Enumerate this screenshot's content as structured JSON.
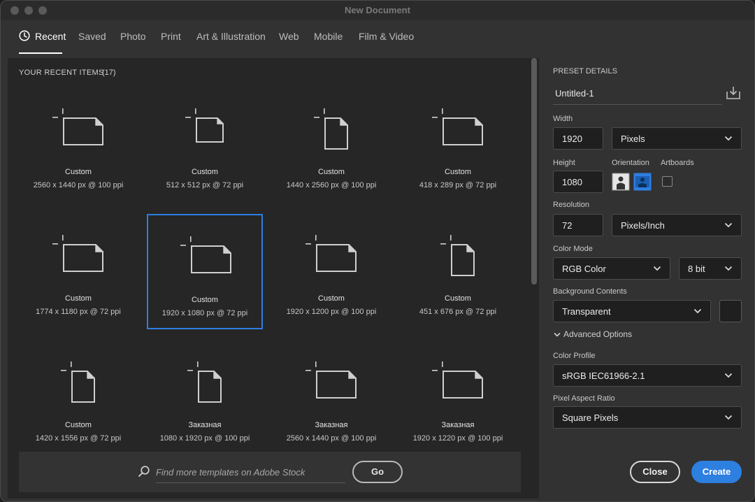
{
  "window": {
    "title": "New Document"
  },
  "tabs": [
    {
      "label": "Recent"
    },
    {
      "label": "Saved"
    },
    {
      "label": "Photo"
    },
    {
      "label": "Print"
    },
    {
      "label": "Art & Illustration"
    },
    {
      "label": "Web"
    },
    {
      "label": "Mobile"
    },
    {
      "label": "Film & Video"
    }
  ],
  "recent": {
    "title": "YOUR RECENT ITEMS",
    "count": "(17)",
    "items": [
      {
        "name": "Custom",
        "size": "2560 x 1440 px @ 100 ppi",
        "orientation": "landscape"
      },
      {
        "name": "Custom",
        "size": "512 x 512 px @ 72 ppi",
        "orientation": "square"
      },
      {
        "name": "Custom",
        "size": "1440 x 2560 px @ 100 ppi",
        "orientation": "portrait"
      },
      {
        "name": "Custom",
        "size": "418 x 289 px @ 72 ppi",
        "orientation": "landscape"
      },
      {
        "name": "Custom",
        "size": "1774 x 1180 px @ 72 ppi",
        "orientation": "landscape"
      },
      {
        "name": "Custom",
        "size": "1920 x 1080 px @ 72 ppi",
        "orientation": "landscape",
        "selected": true
      },
      {
        "name": "Custom",
        "size": "1920 x 1200 px @ 100 ppi",
        "orientation": "landscape"
      },
      {
        "name": "Custom",
        "size": "451 x 676 px @ 72 ppi",
        "orientation": "portrait"
      },
      {
        "name": "Custom",
        "size": "1420 x 1556 px @ 72 ppi",
        "orientation": "portrait"
      },
      {
        "name": "Заказная",
        "size": "1080 x 1920 px @ 100 ppi",
        "orientation": "portrait"
      },
      {
        "name": "Заказная",
        "size": "2560 x 1440 px @ 100 ppi",
        "orientation": "landscape"
      },
      {
        "name": "Заказная",
        "size": "1920 x 1220 px @ 100 ppi",
        "orientation": "landscape"
      }
    ]
  },
  "search": {
    "placeholder": "Find more templates on Adobe Stock",
    "go_label": "Go"
  },
  "preset": {
    "section_title": "PRESET DETAILS",
    "name": "Untitled-1",
    "width_label": "Width",
    "width_value": "1920",
    "width_unit": "Pixels",
    "height_label": "Height",
    "height_value": "1080",
    "orientation_label": "Orientation",
    "artboards_label": "Artboards",
    "resolution_label": "Resolution",
    "resolution_value": "72",
    "resolution_unit": "Pixels/Inch",
    "color_mode_label": "Color Mode",
    "color_mode_value": "RGB Color",
    "bit_depth_value": "8 bit",
    "background_label": "Background Contents",
    "background_value": "Transparent",
    "advanced_label": "Advanced Options",
    "color_profile_label": "Color Profile",
    "color_profile_value": "sRGB IEC61966-2.1",
    "pixel_aspect_label": "Pixel Aspect Ratio",
    "pixel_aspect_value": "Square Pixels"
  },
  "actions": {
    "close_label": "Close",
    "create_label": "Create"
  },
  "colors": {
    "accent": "#2d7fe0",
    "panel": "#262626",
    "window": "#323232"
  }
}
